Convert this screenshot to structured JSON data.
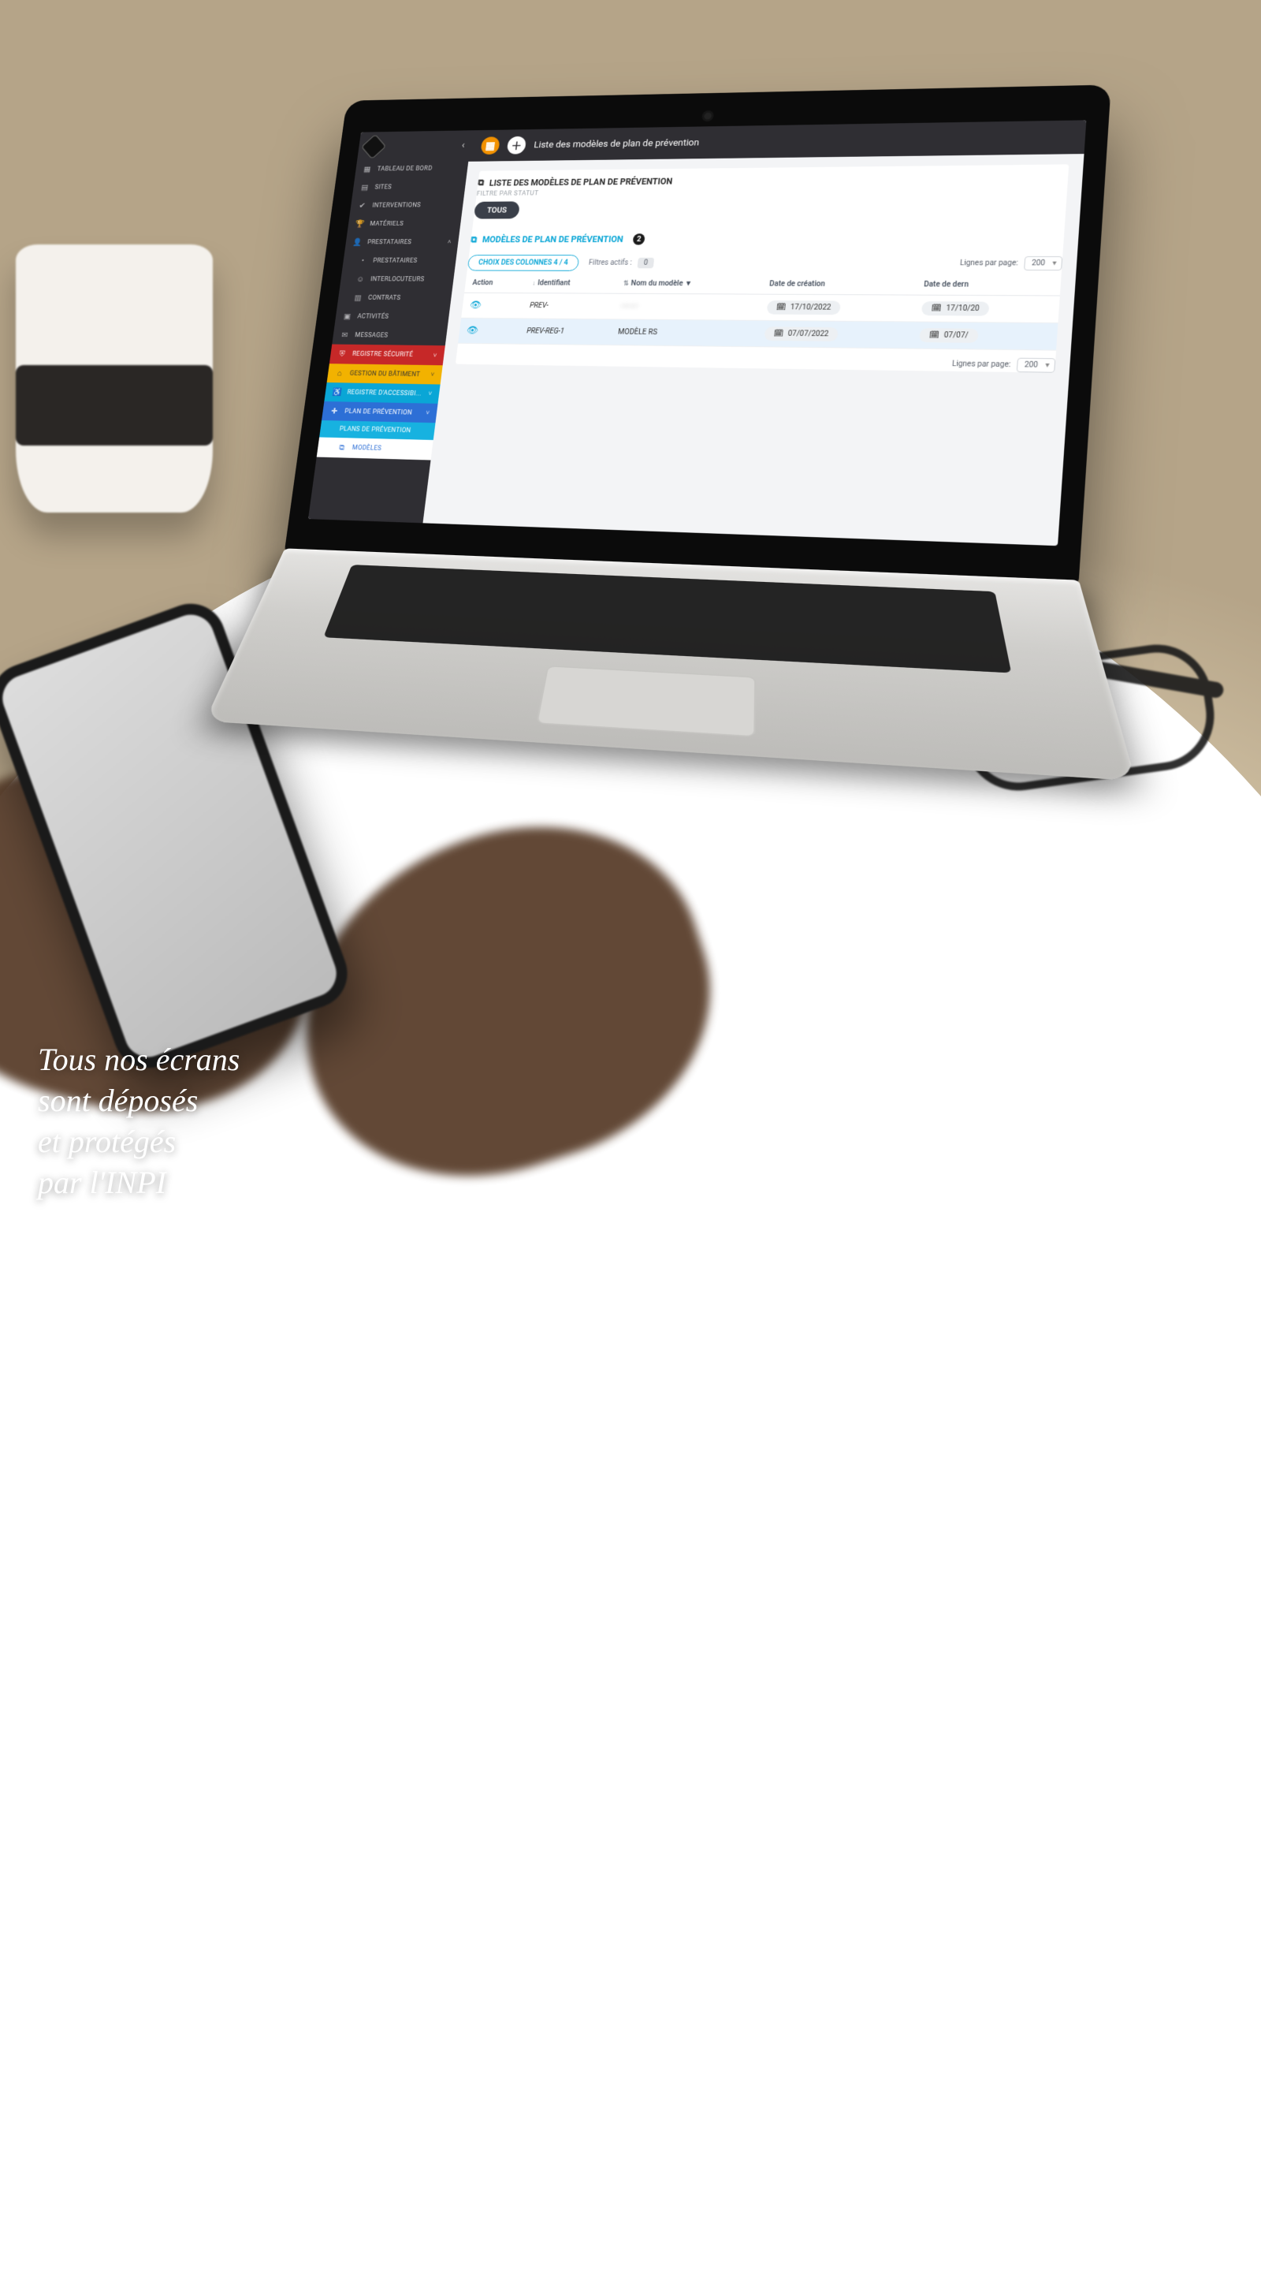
{
  "caption": {
    "line1": "Tous nos écrans",
    "line2": "sont déposés",
    "line3": "et protégés",
    "line4": "par l'INPI"
  },
  "topbar": {
    "title": "Liste des modèles de plan de prévention"
  },
  "sidebar": {
    "items": [
      {
        "label": "TABLEAU DE BORD",
        "icon": "grid"
      },
      {
        "label": "SITES",
        "icon": "doc"
      },
      {
        "label": "INTERVENTIONS",
        "icon": "check"
      },
      {
        "label": "MATÉRIELS",
        "icon": "trophy"
      },
      {
        "label": "PRESTATAIRES",
        "icon": "user",
        "expandable": true
      },
      {
        "label": "PRESTATAIRES",
        "icon": "",
        "sub": true
      },
      {
        "label": "INTERLOCUTEURS",
        "icon": "person",
        "sub": true
      },
      {
        "label": "CONTRATS",
        "icon": "file",
        "sub": true
      },
      {
        "label": "ACTIVITÉS",
        "icon": "clip"
      },
      {
        "label": "MESSAGES",
        "icon": "mail"
      }
    ],
    "colored": [
      {
        "label": "REGISTRE SÉCURITÉ",
        "cls": "red",
        "expandable": true,
        "icon": "shield"
      },
      {
        "label": "GESTION DU BÂTIMENT",
        "cls": "yellow",
        "expandable": true,
        "icon": "build"
      },
      {
        "label": "REGISTRE D'ACCESSIBI...",
        "cls": "cyan",
        "expandable": true,
        "icon": "access"
      },
      {
        "label": "PLAN DE PRÉVENTION",
        "cls": "blue",
        "expandable": true,
        "icon": "plan"
      },
      {
        "label": "PLANS DE PRÉVENTION",
        "cls": "teal",
        "sub2": true,
        "icon": ""
      },
      {
        "label": "MODÈLES",
        "cls": "white",
        "sub2": true,
        "icon": "copy"
      }
    ]
  },
  "section": {
    "header": "LISTE DES MODÈLES DE PLAN DE PRÉVENTION",
    "filter_label": "FILTRE PAR STATUT",
    "filter_all": "TOUS",
    "sub_header": "MODÈLES DE PLAN DE PRÉVENTION",
    "sub_count": "2",
    "choose_cols": "CHOIX DES COLONNES 4 / 4",
    "filters_active_label": "Filtres actifs :",
    "filters_active_count": "0",
    "lines_per_page_label": "Lignes par page:",
    "lines_per_page_value": "200"
  },
  "table": {
    "headers": {
      "action": "Action",
      "id": "Identifiant",
      "name": "Nom du modèle",
      "created": "Date de création",
      "last": "Date de dern"
    },
    "rows": [
      {
        "id": "PREV-",
        "name": "———",
        "created": "17/10/2022",
        "last": "17/10/20"
      },
      {
        "id": "PREV-REG-1",
        "name": "MODÈLE RS",
        "created": "07/07/2022",
        "last": "07/07/"
      }
    ]
  }
}
